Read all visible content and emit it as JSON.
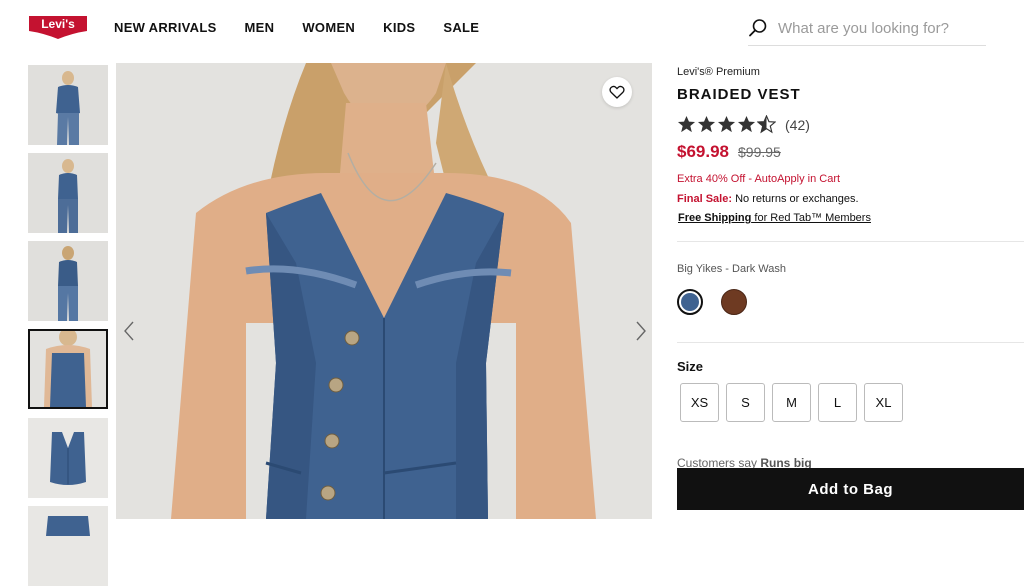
{
  "header": {
    "logo_text": "Levi's",
    "nav": [
      "NEW ARRIVALS",
      "MEN",
      "WOMEN",
      "KIDS",
      "SALE"
    ],
    "search_placeholder": "What are you looking for?"
  },
  "gallery": {
    "thumbnail_count": 6,
    "active_thumbnail": 4
  },
  "product": {
    "brand": "Levi's® Premium",
    "title": "BRAIDED VEST",
    "rating": 4.5,
    "review_count": "(42)",
    "sale_price": "$69.98",
    "original_price": "$99.95",
    "promo": "Extra 40% Off - AutoApply in Cart",
    "final_sale_label": "Final Sale:",
    "final_sale_text": " No returns or exchanges.",
    "shipping_bold": "Free Shipping",
    "shipping_text": " for Red Tab™ Members",
    "color_name": "Big Yikes - Dark Wash",
    "swatches": [
      {
        "name": "dark-wash",
        "color": "#3f6290",
        "selected": true
      },
      {
        "name": "brown",
        "color": "#6e3a22",
        "selected": false
      }
    ],
    "size_label": "Size",
    "sizes": [
      "XS",
      "S",
      "M",
      "L",
      "XL"
    ],
    "fit_note_prefix": "Customers say ",
    "fit_note_value": "Runs big",
    "add_to_bag": "Add to Bag"
  },
  "colors": {
    "brand_red": "#c41230",
    "sale_red": "#c41230",
    "denim": "#3f6290"
  }
}
